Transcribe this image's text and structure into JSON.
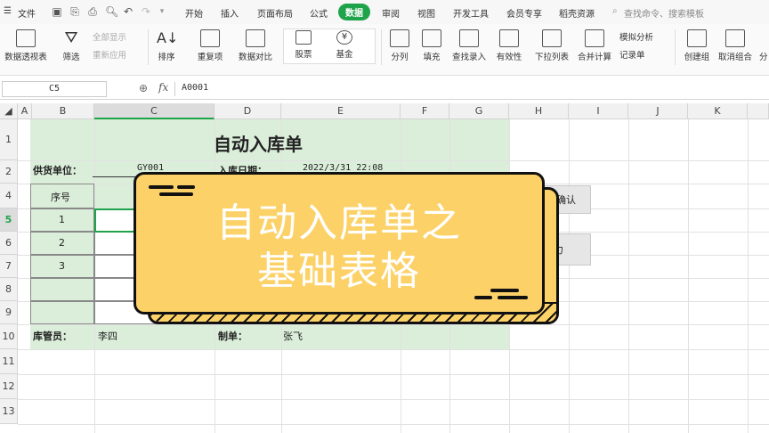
{
  "menu": {
    "file": "文件",
    "tabs": [
      "开始",
      "插入",
      "页面布局",
      "公式",
      "数据",
      "审阅",
      "视图",
      "开发工具",
      "会员专享",
      "稻壳资源"
    ],
    "active_tab": "数据",
    "search_placeholder": "查找命令、搜索模板"
  },
  "ribbon": {
    "pivot": "数据透视表",
    "filter": "筛选",
    "show_all": "全部显示",
    "reapply": "重新应用",
    "sort": "排序",
    "duplicates": "重复项",
    "compare": "数据对比",
    "stock": "股票",
    "fund": "基金",
    "split": "分列",
    "fill": "填充",
    "lookup_entry": "查找录入",
    "validity": "有效性",
    "dropdown": "下拉列表",
    "consolidate": "合并计算",
    "what_if": "模拟分析",
    "record_sheet": "记录单",
    "group": "创建组",
    "ungroup": "取消组合",
    "more": "分"
  },
  "formula_bar": {
    "cell_ref": "C5",
    "fx": "fx",
    "value": "A0001"
  },
  "columns": [
    "A",
    "B",
    "C",
    "D",
    "E",
    "F",
    "G",
    "H",
    "I",
    "J",
    "K"
  ],
  "selected_column": "C",
  "rows": [
    "1",
    "2",
    "4",
    "5",
    "6",
    "7",
    "8",
    "9",
    "10",
    "11",
    "12",
    "13"
  ],
  "selected_row": "5",
  "sheet": {
    "title": "自动入库单",
    "supplier_label": "供货单位：",
    "supplier_value": "GY001",
    "date_label": "入库日期：",
    "date_value": "2022/3/31 22:08",
    "seq_header": "序号",
    "seq": [
      "1",
      "2",
      "3"
    ],
    "keeper_label": "库管员：",
    "keeper_value": "李四",
    "maker_label": "制单：",
    "maker_value": "张飞",
    "confirm_btn_partial": "确认",
    "second_btn_partial": "力"
  },
  "overlay": {
    "title_line1": "自动入库单之",
    "title_line2": "基础表格",
    "color": "#fcd167"
  }
}
